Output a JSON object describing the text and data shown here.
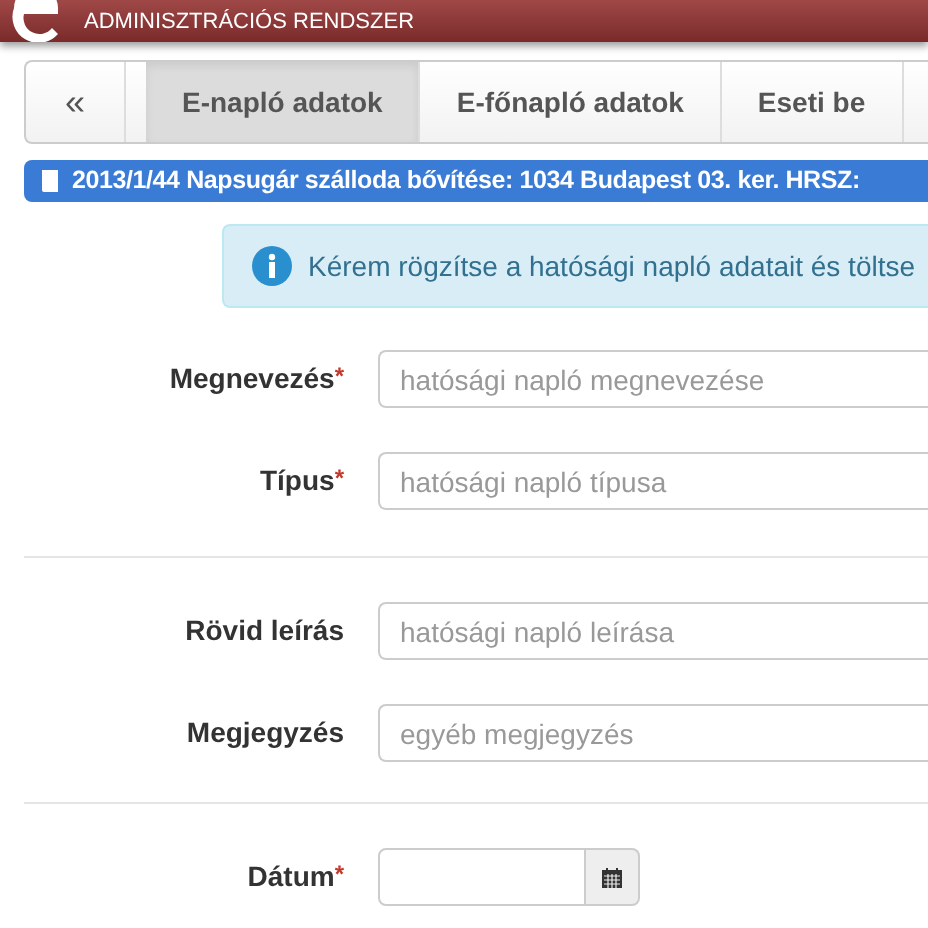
{
  "header": {
    "subtitle": "ADMINISZTRÁCIÓS RENDSZER"
  },
  "tabs": [
    {
      "label": "«",
      "kind": "back",
      "selected": false
    },
    {
      "label": "E-napló adatok",
      "kind": "tab",
      "selected": true
    },
    {
      "label": "E-főnapló adatok",
      "kind": "tab",
      "selected": false
    },
    {
      "label": "Eseti be",
      "kind": "tab",
      "selected": false
    }
  ],
  "project_bar": "2013/1/44 Napsugár szálloda bővítése: 1034 Budapest 03. ker. HRSZ:",
  "info_alert": "Kérem rögzítse a hatósági napló adatait és töltse",
  "form_groups": [
    [
      {
        "label": "Megnevezés",
        "required_mark": "*",
        "kind": "text",
        "placeholder": "hatósági napló megnevezése"
      },
      {
        "label": "Típus",
        "required_mark": "*",
        "kind": "text",
        "placeholder": "hatósági napló típusa"
      }
    ],
    [
      {
        "label": "Rövid leírás",
        "kind": "text",
        "placeholder": "hatósági napló leírása"
      },
      {
        "label": "Megjegyzés",
        "kind": "text",
        "placeholder": "egyéb megjegyzés"
      }
    ],
    [
      {
        "label": "Dátum",
        "required_mark": "*",
        "kind": "date"
      }
    ]
  ]
}
